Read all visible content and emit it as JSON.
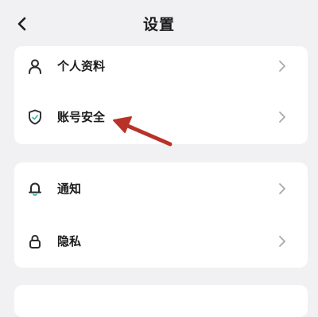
{
  "header": {
    "title": "设置",
    "back_icon": "chevron-left-icon"
  },
  "groups": [
    {
      "items": [
        {
          "label": "个人资料",
          "icon": "person-icon"
        },
        {
          "label": "账号安全",
          "icon": "shield-check-icon"
        }
      ]
    },
    {
      "items": [
        {
          "label": "通知",
          "icon": "bell-icon"
        },
        {
          "label": "隐私",
          "icon": "lock-icon"
        }
      ]
    }
  ],
  "annotation": {
    "arrow_color": "#c0392b",
    "target": "账号安全"
  },
  "colors": {
    "background": "#f1f1f3",
    "card": "#ffffff",
    "icon": "#2b2b2e",
    "chevron": "#a9a9ad"
  }
}
